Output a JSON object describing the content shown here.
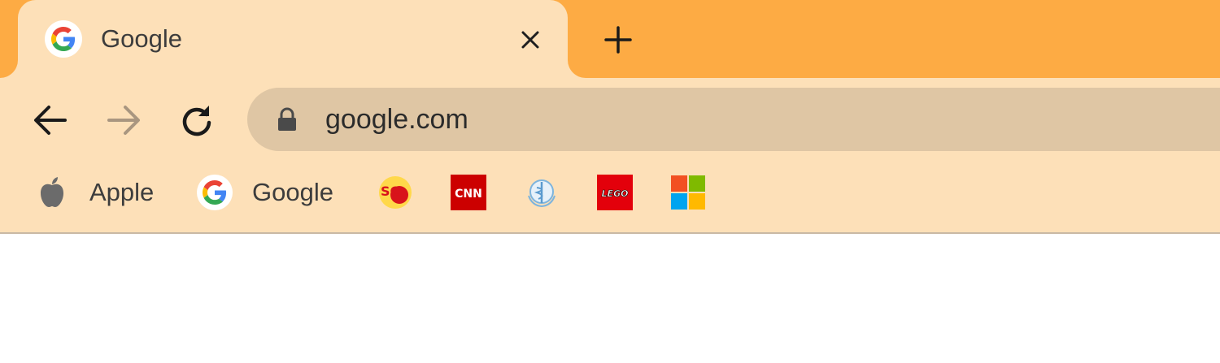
{
  "tab": {
    "title": "Google",
    "favicon": "google-g-icon"
  },
  "toolbar": {
    "back_icon": "back-arrow-icon",
    "forward_icon": "forward-arrow-icon",
    "reload_icon": "reload-icon"
  },
  "omnibox": {
    "url": "google.com",
    "secure_icon": "lock-icon"
  },
  "bookmarks": [
    {
      "label": "Apple",
      "icon": "apple-icon"
    },
    {
      "label": "Google",
      "icon": "google-g-icon"
    },
    {
      "label": "",
      "icon": "sc-logo-icon"
    },
    {
      "label": "",
      "icon": "cnn-icon"
    },
    {
      "label": "",
      "icon": "who-emblem-icon"
    },
    {
      "label": "",
      "icon": "lego-icon"
    },
    {
      "label": "",
      "icon": "microsoft-icon"
    }
  ],
  "icon_text": {
    "cnn": "CNN",
    "lego": "LEGO",
    "sc": "SC"
  },
  "colors": {
    "tabstrip": "#fdab44",
    "toolbar": "#fde0b8",
    "omnibox": "#dfc6a4"
  }
}
